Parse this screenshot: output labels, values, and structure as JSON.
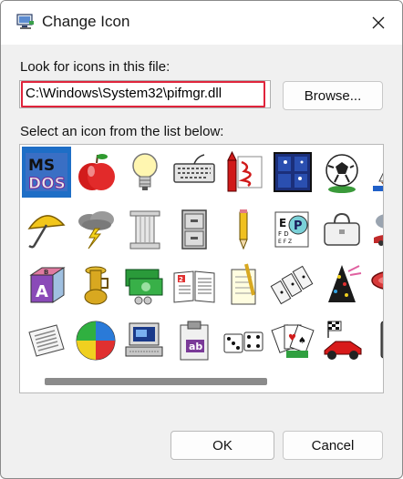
{
  "window": {
    "title": "Change Icon",
    "app_icon": "monitor-icon"
  },
  "file": {
    "label": "Look for icons in this file:",
    "value": "C:\\Windows\\System32\\pifmgr.dll",
    "browse_label": "Browse..."
  },
  "list": {
    "label": "Select an icon from the list below:",
    "selected_index": 0,
    "icons": [
      "ms-dos-icon",
      "apple-icon",
      "lightbulb-icon",
      "keyboard-icon",
      "crayon-icon",
      "window-icon",
      "soccer-ball-icon",
      "sailboat-icon",
      "umbrella-icon",
      "storm-cloud-icon",
      "column-icon",
      "file-cabinet-icon",
      "pencil-icon",
      "eye-chart-icon",
      "bag-icon",
      "rain-cloud-icon",
      "alphabet-block-icon",
      "tuba-icon",
      "money-icon",
      "book-icon",
      "notepad-icon",
      "dominoes-icon",
      "party-hat-icon",
      "raft-icon",
      "newspaper-icon",
      "beach-ball-icon",
      "computer-icon",
      "clipboard-icon",
      "dice-icon",
      "playing-cards-icon",
      "race-car-icon",
      "traffic-light-icon"
    ]
  },
  "buttons": {
    "ok": "OK",
    "cancel": "Cancel"
  }
}
